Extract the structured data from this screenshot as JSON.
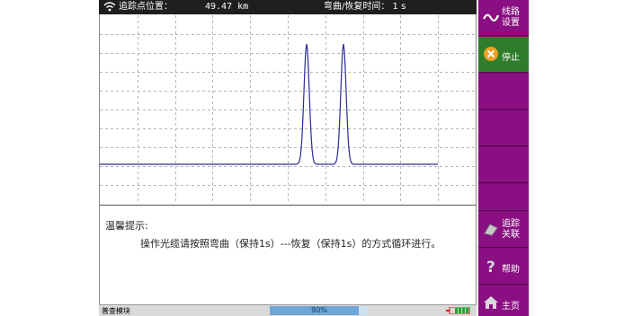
{
  "header": {
    "location_label": "追踪点位置：",
    "distance": "49.47 km",
    "bend_label": "弯曲/恢复时间： 1 s"
  },
  "hint": {
    "title": "温馨提示:",
    "message": "操作光缆请按照弯曲（保持1s）---恢复（保持1s）的方式循环进行。"
  },
  "status": {
    "module": "普查模块",
    "progress": "90%",
    "progress_value": 0.9
  },
  "sidebar": {
    "line_setup": {
      "l1": "线路",
      "l2": "设置"
    },
    "stop": "停止",
    "trace_link": {
      "l1": "追踪",
      "l2": "关联"
    },
    "help": "帮助",
    "home": "主页"
  },
  "colors": {
    "accent": "#8a0f82",
    "stop_bg": "#2f7d2a",
    "trace": "#2a2a9a"
  },
  "icons": [
    "wifi-icon",
    "wave-icon",
    "stop-icon",
    "link-icon",
    "help-icon",
    "home-icon",
    "battery-icon"
  ]
}
